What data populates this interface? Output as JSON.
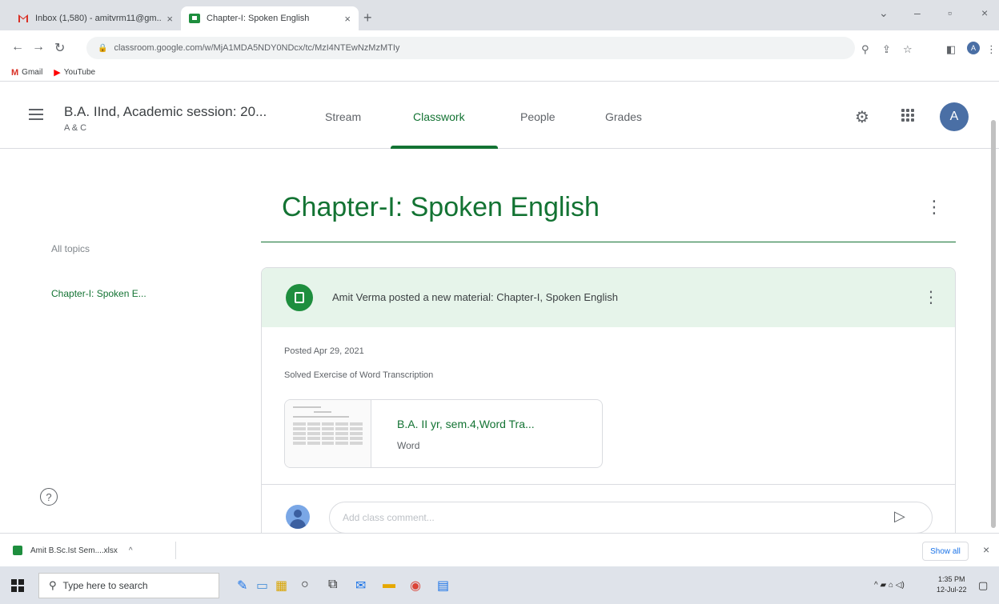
{
  "browser": {
    "tabs": [
      {
        "title": "Inbox (1,580) - amitvrm11@gm...",
        "active": false
      },
      {
        "title": "Chapter-I: Spoken English",
        "active": true
      }
    ],
    "new_tab": "+",
    "url": "classroom.google.com/w/MjA1MDA5NDY0NDcx/tc/MzI4NTEwNzMzMTIy",
    "bookmarks": [
      {
        "label": "Gmail",
        "icon": "gmail-icon"
      },
      {
        "label": "YouTube",
        "icon": "youtube-icon"
      }
    ],
    "window_controls": {
      "minimize": "–",
      "maximize": "▫",
      "close": "×",
      "dropdown": "⌄"
    }
  },
  "classroom": {
    "class_title": "B.A. IInd, Academic session: 20...",
    "class_section": "A & C",
    "nav": [
      {
        "label": "Stream",
        "active": false
      },
      {
        "label": "Classwork",
        "active": true
      },
      {
        "label": "People",
        "active": false
      },
      {
        "label": "Grades",
        "active": false
      }
    ],
    "avatar_letter": "A"
  },
  "sidebar": {
    "all_topics": "All topics",
    "topics": [
      "Chapter-I: Spoken E..."
    ],
    "help": "?"
  },
  "topic": {
    "heading": "Chapter-I: Spoken English"
  },
  "post": {
    "title": "Amit Verma posted a new material: Chapter-I, Spoken English",
    "posted": "Posted Apr 29, 2021",
    "description": "Solved Exercise of Word Transcription",
    "attachment": {
      "name": "B.A. II yr, sem.4,Word Tra...",
      "type": "Word"
    },
    "comment_placeholder": "Add class comment..."
  },
  "downloads": {
    "file": "Amit B.Sc.Ist Sem....xlsx",
    "show_all": "Show all",
    "close": "×"
  },
  "taskbar": {
    "search_placeholder": "Type here to search",
    "time": "1:35 PM",
    "date": "12-Jul-22"
  },
  "colors": {
    "accent_green": "#137333",
    "header_green_bg": "#e6f4ea",
    "avatar_blue": "#4a6fa5"
  }
}
